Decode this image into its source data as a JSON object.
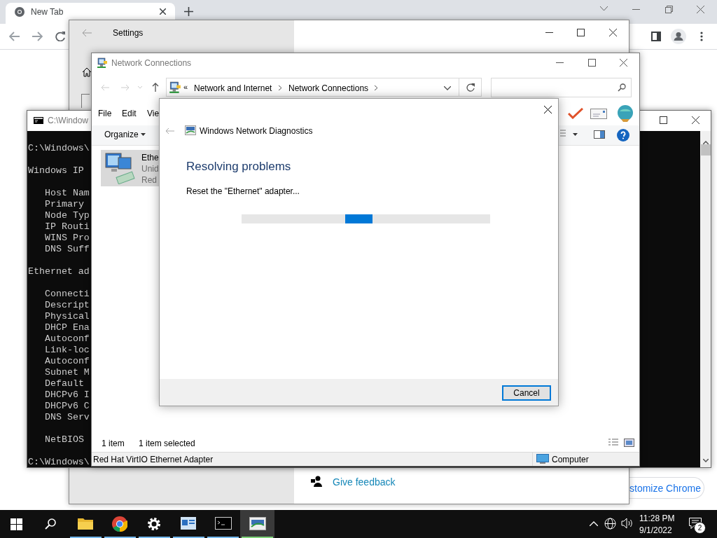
{
  "browser": {
    "tab_title": "New Tab",
    "customize_button": "stomize Chrome"
  },
  "settings": {
    "title": "Settings",
    "feedback_link": "Give feedback"
  },
  "console": {
    "title": "C:\\Window",
    "blocks": [
      {
        "kind": "plain",
        "lines": [
          "C:\\Windows\\"
        ]
      },
      {
        "kind": "plain",
        "lines": [
          "Windows IP"
        ]
      },
      {
        "kind": "indented",
        "lines": [
          "Host Nam",
          "Primary",
          "Node Typ",
          "IP Routi",
          "WINS Pro",
          "DNS Suff"
        ]
      },
      {
        "kind": "plain",
        "lines": [
          "Ethernet ad"
        ]
      },
      {
        "kind": "indented",
        "lines": [
          "Connecti",
          "Descript",
          "Physical",
          "DHCP Ena",
          "Autoconf",
          "Link-loc",
          "Autoconf",
          "Subnet M",
          "Default",
          "DHCPv6 I",
          "DHCPv6 C",
          "DNS Serv"
        ]
      },
      {
        "kind": "indented",
        "lines": [
          "NetBIOS"
        ]
      },
      {
        "kind": "plain",
        "lines": [
          "C:\\Windows\\"
        ]
      }
    ]
  },
  "network_connections": {
    "title": "Network Connections",
    "overflow_chevron": "«",
    "path": [
      "Network and Internet",
      "Network Connections"
    ],
    "menu": [
      "File",
      "Edit",
      "Vie"
    ],
    "organize": "Organize",
    "items": [
      {
        "name": "Ethe",
        "status": "Unid",
        "device": "Red",
        "selected": true
      }
    ],
    "item_count": "1 item",
    "selection": "1 item selected",
    "details": {
      "description": "Red Hat VirtIO Ethernet Adapter",
      "location": "Computer"
    }
  },
  "dialog": {
    "title": "Windows Network Diagnostics",
    "heading": "Resolving problems",
    "message": "Reset the \"Ethernet\" adapter...",
    "progress": {
      "indeterminate": true
    },
    "cancel": "Cancel"
  },
  "taskbar": {
    "apps": [
      {
        "kind": "explorer",
        "selected": false
      },
      {
        "kind": "chrome",
        "selected": false
      },
      {
        "kind": "settings",
        "selected": false
      },
      {
        "kind": "network",
        "selected": false
      },
      {
        "kind": "console",
        "selected": false
      },
      {
        "kind": "diagnostics",
        "selected": true
      }
    ],
    "time": "11:28 PM",
    "date": "9/1/2022",
    "notifications": "2"
  }
}
